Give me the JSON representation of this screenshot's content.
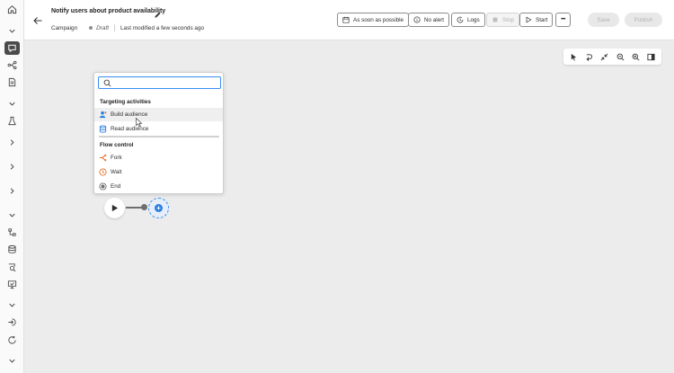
{
  "header": {
    "title": "Notify users about product availability",
    "breadcrumb_campaign": "Campaign",
    "status": "Draft",
    "last_modified": "Last modified a few seconds ago",
    "schedule_label": "As soon as possible",
    "alert_label": "No alert",
    "logs_label": "Logs",
    "stop_label": "Stop",
    "start_label": "Start",
    "more_label": "•••",
    "save_label": "Save",
    "publish_label": "Publish"
  },
  "rail": {
    "icons": [
      "home-icon",
      "chevron-down-icon",
      "campaign-icon",
      "journey-icon",
      "document-icon",
      "chevron-down-icon",
      "flask-icon",
      "chevron-right-icon",
      "chevron-right-icon",
      "chevron-right-icon",
      "chevron-down-icon",
      "workflow-icon",
      "database-icon",
      "search-data-icon",
      "monitor-icon",
      "chevron-down-icon",
      "login-icon",
      "refresh-icon",
      "chevron-down-icon"
    ]
  },
  "toolbar": {
    "tools": [
      "select-icon",
      "undo-icon",
      "collapse-icon",
      "zoom-out-icon",
      "zoom-in-icon",
      "panel-icon"
    ]
  },
  "popover": {
    "search_placeholder": "",
    "section_targeting": "Targeting activities",
    "item_build": "Build audience",
    "item_read": "Read audience",
    "section_flow": "Flow control",
    "item_fork": "Fork",
    "item_wait": "Wait",
    "item_end": "End"
  },
  "colors": {
    "accent": "#378ef0",
    "rail_active": "#4b4b4b",
    "canvas": "#ececec",
    "fork_orange": "#e0702a"
  }
}
